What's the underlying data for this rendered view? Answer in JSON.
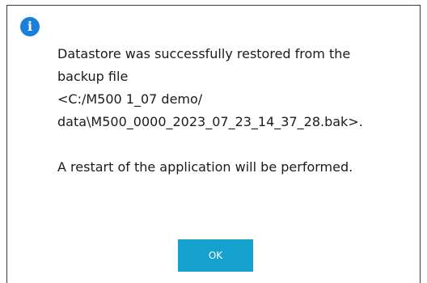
{
  "dialog": {
    "icon": "info-icon",
    "icon_glyph": "i",
    "icon_color": "#1a7fd8",
    "message_lines": [
      "Datastore was successfully restored from the",
      "backup file",
      "<C:/M500 1_07 demo/",
      "data\\M500_0000_2023_07_23_14_37_28.bak>."
    ],
    "restart_notice": "A restart of the application will be performed.",
    "ok_label": "OK",
    "ok_color": "#16a2cf"
  }
}
